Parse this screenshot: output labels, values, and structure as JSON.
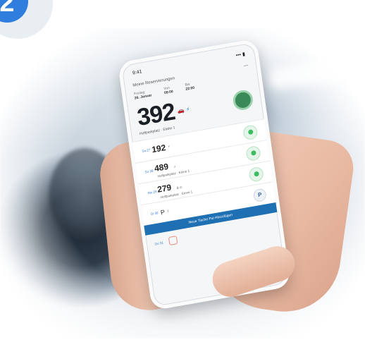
{
  "step": {
    "number": "2"
  },
  "phone": {
    "status": {
      "time": "9:41",
      "signal": "••• ▮"
    },
    "header": {
      "title": "Meine Reservierungen",
      "menu": "—"
    },
    "meta": [
      {
        "label": "Freitag",
        "value": "26. Januar"
      },
      {
        "label": "Von",
        "value": "09:00"
      },
      {
        "label": "Bis",
        "value": "22:00"
      }
    ],
    "featured": {
      "number": "392",
      "icons": "🚗 ⚡",
      "subtitle": "Hoffparkplatz · Etahe 1"
    },
    "rows": [
      {
        "day": "Sa 27",
        "number": "192",
        "suffix": "⚡",
        "sub": "",
        "status": "green"
      },
      {
        "day": "So 28",
        "number": "489",
        "suffix": "⚡",
        "sub": "Hoffparkplatz · Etone 1",
        "status": "green"
      },
      {
        "day": "Mo 29",
        "number": "279",
        "suffix": "B ⊙",
        "sub": "Hoffparkplatz · Etone 1",
        "status": "green"
      },
      {
        "day": "Di 30",
        "number": "P",
        "suffix": "⚡",
        "sub": "",
        "status": "p"
      }
    ],
    "cta_label": "Neue Tische Pul Hinzufügen",
    "footer": {
      "day": "Do 31"
    }
  },
  "colors": {
    "accent": "#2f7ddc",
    "ok": "#3cbb63",
    "cta": "#1f6fb3"
  }
}
